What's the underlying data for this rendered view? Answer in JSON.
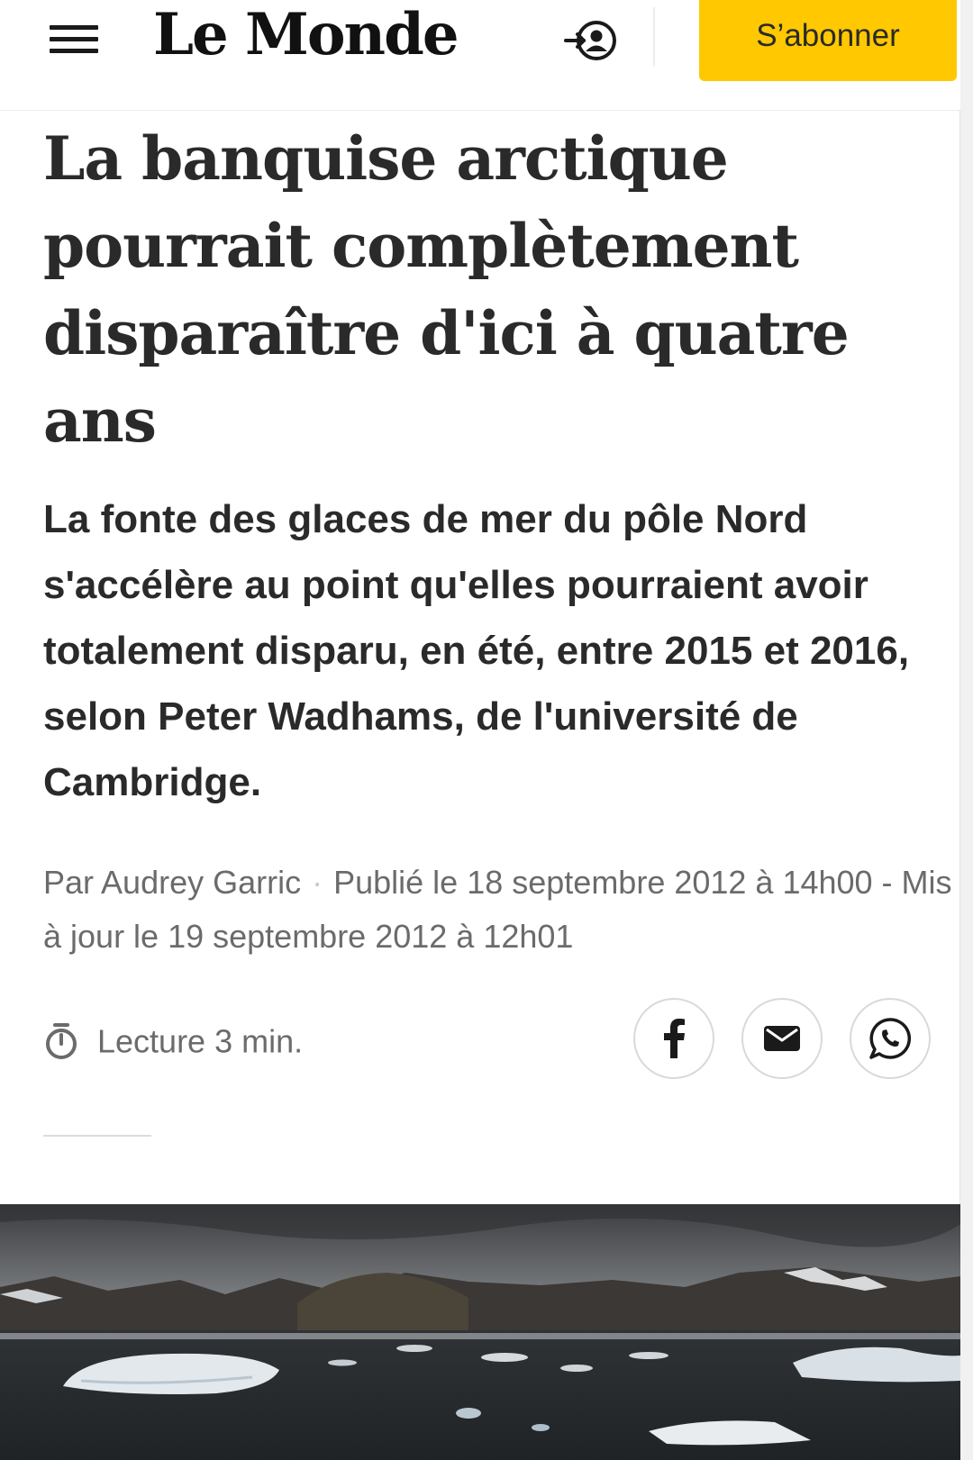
{
  "header": {
    "logo": "Le Monde",
    "subscribe_label": "S’abonner",
    "icons": [
      "menu-icon",
      "login-icon"
    ]
  },
  "article": {
    "title": "La banquise arctique pourrait complètement disparaître d'ici à quatre ans",
    "lead": "La fonte des glaces de mer du pôle Nord s'accélère au point qu'elles pourraient avoir totalement disparu, en été, entre 2015 et 2016, selon Peter Wadhams, de l'université de Cambridge.",
    "byline": "Par Audrey Garric",
    "published": "Publié le 18 septembre 2012 à 14h00 - Mis à jour le 19 septembre 2012 à 12h01",
    "reading_time": "Lecture 3 min."
  },
  "share": {
    "icons": [
      "facebook-icon",
      "email-icon",
      "whatsapp-icon"
    ]
  },
  "colors": {
    "subscribe_bg": "#ffc800",
    "text": "#2a2a2a",
    "meta": "#6b6b6b"
  }
}
